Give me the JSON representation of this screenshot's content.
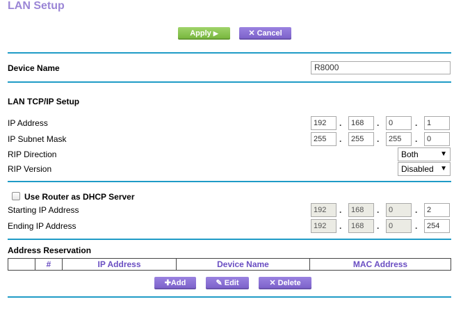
{
  "page": {
    "title": "LAN Setup"
  },
  "actions": {
    "apply_label": "Apply",
    "apply_icon": "▶",
    "cancel_label": "Cancel",
    "cancel_icon": "✕"
  },
  "device": {
    "label": "Device Name",
    "value": "R8000"
  },
  "lan": {
    "section_title": "LAN TCP/IP Setup",
    "ip_label": "IP Address",
    "ip": [
      "192",
      "168",
      "0",
      "1"
    ],
    "mask_label": "IP Subnet Mask",
    "mask": [
      "255",
      "255",
      "255",
      "0"
    ],
    "rip_direction_label": "RIP Direction",
    "rip_direction_value": "Both",
    "rip_version_label": "RIP Version",
    "rip_version_value": "Disabled"
  },
  "dhcp": {
    "checkbox_label": "Use Router as DHCP Server",
    "checked": false,
    "start_label": "Starting IP Address",
    "start": [
      "192",
      "168",
      "0",
      "2"
    ],
    "end_label": "Ending IP Address",
    "end": [
      "192",
      "168",
      "0",
      "254"
    ]
  },
  "reservation": {
    "title": "Address Reservation",
    "columns": [
      "",
      "#",
      "IP Address",
      "Device Name",
      "MAC Address"
    ],
    "add_label": "Add",
    "add_icon": "✚",
    "edit_label": "Edit",
    "edit_icon": "✎",
    "delete_label": "Delete",
    "delete_icon": "✕"
  },
  "colors": {
    "accent": "#1f9bc6",
    "title": "#9b86d6",
    "apply": "#8cc452",
    "purple": "#8a70d6"
  }
}
